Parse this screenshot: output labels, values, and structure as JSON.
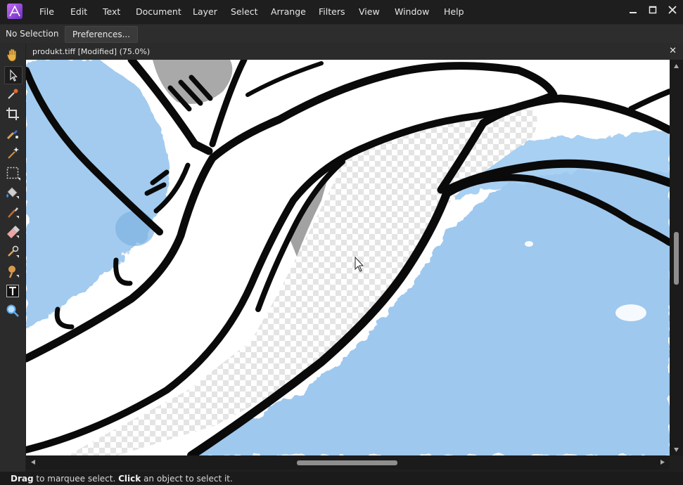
{
  "app": {
    "menu": [
      "File",
      "Edit",
      "Text",
      "Document",
      "Layer",
      "Select",
      "Arrange",
      "Filters",
      "View",
      "Window",
      "Help"
    ]
  },
  "context": {
    "selection_label": "No Selection",
    "preferences_label": "Preferences..."
  },
  "document": {
    "title": "produkt.tiff [Modified] (75.0%)",
    "close_glyph": "✕"
  },
  "tools": [
    "hand-icon",
    "move-icon",
    "color-picker-icon",
    "crop-icon",
    "inpainting-icon",
    "flood-select-icon",
    "marquee-icon",
    "fill-icon",
    "paint-brush-icon",
    "eraser-icon",
    "clone-icon",
    "dodge-icon",
    "text-icon",
    "zoom-icon"
  ],
  "status": {
    "drag_word": "Drag",
    "drag_rest": " to marquee select. ",
    "click_word": "Click",
    "click_rest": " an object to select it."
  },
  "colors": {
    "accent": "#8e44d6",
    "watercolor": "#9cc7ec",
    "ink": "#0a0a0a"
  }
}
